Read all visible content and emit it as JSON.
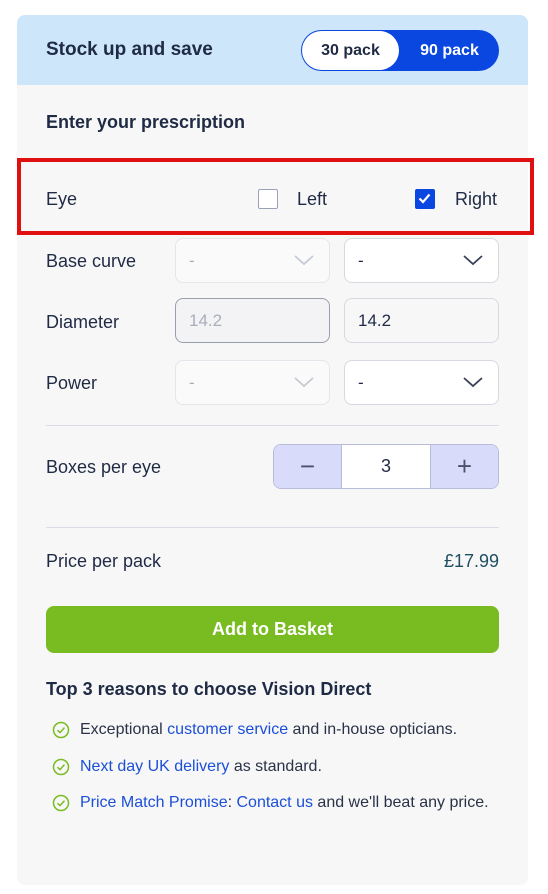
{
  "stock": {
    "title": "Stock up and save",
    "pack_30": "30 pack",
    "pack_90": "90 pack",
    "selected": "90 pack"
  },
  "prescription": {
    "title": "Enter your prescription",
    "eye_label": "Eye",
    "left_label": "Left",
    "right_label": "Right",
    "left_checked": false,
    "right_checked": true,
    "base_curve": {
      "label": "Base curve",
      "left_value": "-",
      "right_value": "-"
    },
    "diameter": {
      "label": "Diameter",
      "left_value": "14.2",
      "right_value": "14.2"
    },
    "power": {
      "label": "Power",
      "left_value": "-",
      "right_value": "-"
    }
  },
  "boxes": {
    "label": "Boxes per eye",
    "minus": "−",
    "plus": "+",
    "value": "3"
  },
  "price": {
    "label": "Price per pack",
    "value": "£17.99"
  },
  "add_button": "Add to Basket",
  "reasons": {
    "title": "Top 3 reasons to choose Vision Direct",
    "items": [
      {
        "pre": "Exceptional ",
        "link": "customer service",
        "post": " and in-house opticians."
      },
      {
        "pre": "",
        "link": "Next day UK delivery",
        "post": " as standard."
      },
      {
        "pre": "",
        "link": "Price Match Promise",
        "mid": ": ",
        "link2": "Contact us",
        "post": " and we'll beat any price."
      }
    ]
  },
  "colors": {
    "brand_blue": "#0a46e0",
    "header_bg": "#cde6fa",
    "add_button_green": "#78bc21",
    "highlight_red": "#e01010",
    "link_blue": "#1b4fd6"
  }
}
